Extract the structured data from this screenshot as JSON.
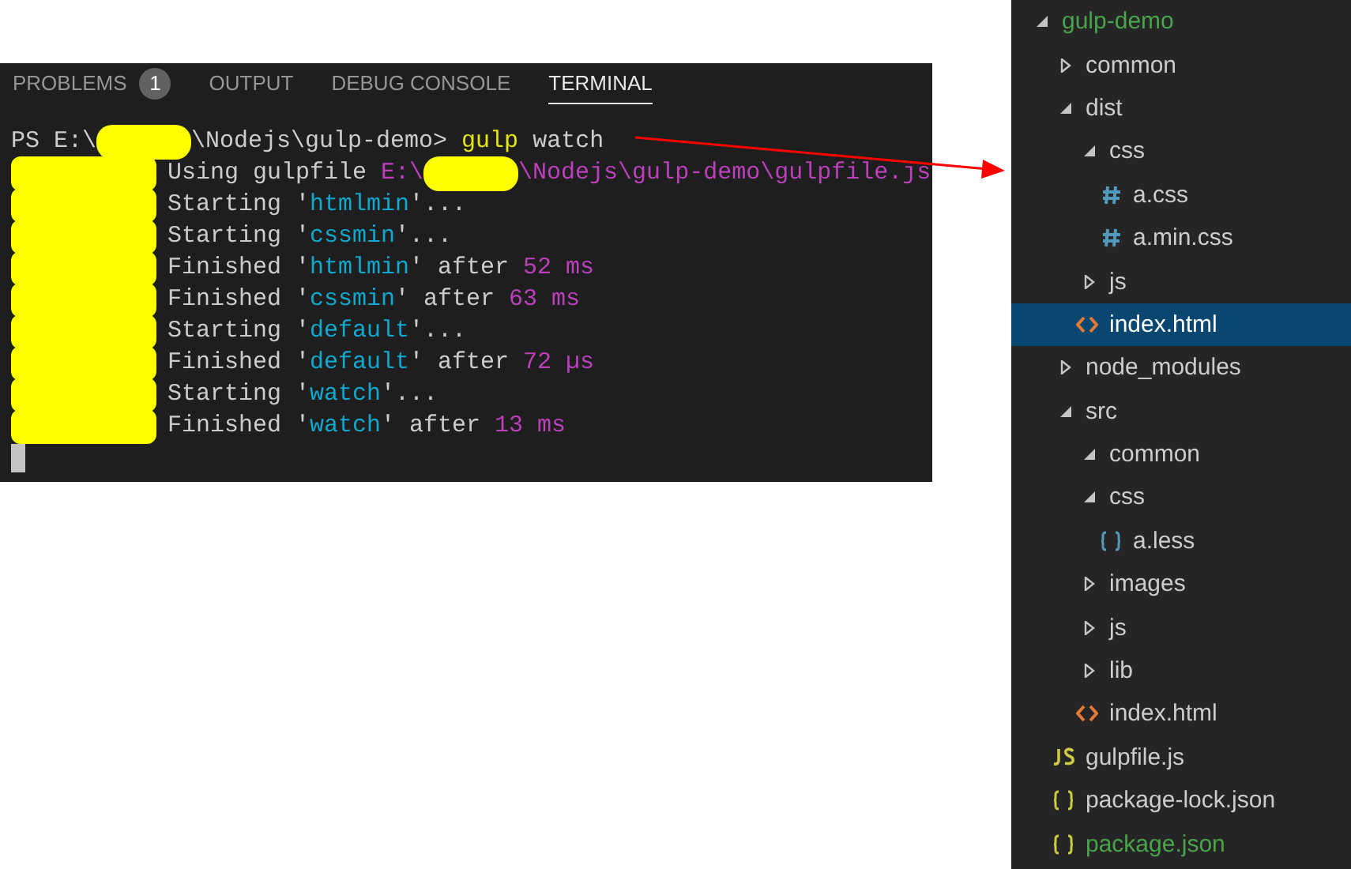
{
  "panel": {
    "tabs": [
      {
        "label": "PROBLEMS",
        "badge": "1",
        "selected": false
      },
      {
        "label": "OUTPUT",
        "selected": false
      },
      {
        "label": "DEBUG CONSOLE",
        "selected": false
      },
      {
        "label": "TERMINAL",
        "selected": true
      }
    ],
    "terminal": {
      "lines": [
        [
          {
            "kind": "plain",
            "text": "PS E:\\"
          },
          {
            "kind": "redaction"
          },
          {
            "kind": "plain",
            "text": "\\Nodejs\\gulp-demo> "
          },
          {
            "kind": "command",
            "text": "gulp"
          },
          {
            "kind": "plain",
            "text": " watch"
          }
        ],
        [
          {
            "kind": "redaction"
          },
          {
            "kind": "plain",
            "text": "Using gulpfile "
          },
          {
            "kind": "number",
            "text": "E:\\"
          },
          {
            "kind": "redaction"
          },
          {
            "kind": "number",
            "text": "\\Nodejs\\gulp-demo\\gulpfile.js"
          }
        ],
        [
          {
            "kind": "redaction"
          },
          {
            "kind": "plain",
            "text": "Starting '"
          },
          {
            "kind": "string",
            "text": "htmlmin"
          },
          {
            "kind": "plain",
            "text": "'..."
          }
        ],
        [
          {
            "kind": "redaction"
          },
          {
            "kind": "plain",
            "text": "Starting '"
          },
          {
            "kind": "string",
            "text": "cssmin"
          },
          {
            "kind": "plain",
            "text": "'..."
          }
        ],
        [
          {
            "kind": "redaction"
          },
          {
            "kind": "plain",
            "text": "Finished '"
          },
          {
            "kind": "string",
            "text": "htmlmin"
          },
          {
            "kind": "plain",
            "text": "' after "
          },
          {
            "kind": "number",
            "text": "52 ms"
          }
        ],
        [
          {
            "kind": "redaction"
          },
          {
            "kind": "plain",
            "text": "Finished '"
          },
          {
            "kind": "string",
            "text": "cssmin"
          },
          {
            "kind": "plain",
            "text": "' after "
          },
          {
            "kind": "number",
            "text": "63 ms"
          }
        ],
        [
          {
            "kind": "redaction"
          },
          {
            "kind": "plain",
            "text": "Starting '"
          },
          {
            "kind": "string",
            "text": "default"
          },
          {
            "kind": "plain",
            "text": "'..."
          }
        ],
        [
          {
            "kind": "redaction"
          },
          {
            "kind": "plain",
            "text": "Finished '"
          },
          {
            "kind": "string",
            "text": "default"
          },
          {
            "kind": "plain",
            "text": "' after "
          },
          {
            "kind": "number",
            "text": "72 µs"
          }
        ],
        [
          {
            "kind": "redaction"
          },
          {
            "kind": "plain",
            "text": "Starting '"
          },
          {
            "kind": "string",
            "text": "watch"
          },
          {
            "kind": "plain",
            "text": "'..."
          }
        ],
        [
          {
            "kind": "redaction"
          },
          {
            "kind": "plain",
            "text": "Finished '"
          },
          {
            "kind": "string",
            "text": "watch"
          },
          {
            "kind": "plain",
            "text": "' after "
          },
          {
            "kind": "number",
            "text": "13 ms"
          }
        ],
        [
          {
            "kind": "cursor"
          }
        ]
      ]
    }
  },
  "explorer": {
    "tree": [
      {
        "label": "gulp-demo",
        "kind": "folder",
        "expanded": true,
        "selected": false,
        "untracked": true,
        "children": [
          {
            "label": "common",
            "kind": "folder",
            "expanded": false,
            "selected": false,
            "untracked": false
          },
          {
            "label": "dist",
            "kind": "folder",
            "expanded": true,
            "selected": false,
            "untracked": false,
            "children": [
              {
                "label": "css",
                "kind": "folder",
                "expanded": true,
                "selected": false,
                "untracked": false,
                "children": [
                  {
                    "label": "a.css",
                    "kind": "css",
                    "selected": false,
                    "untracked": false
                  },
                  {
                    "label": "a.min.css",
                    "kind": "css",
                    "selected": false,
                    "untracked": false
                  }
                ]
              },
              {
                "label": "js",
                "kind": "folder",
                "expanded": false,
                "selected": false,
                "untracked": false
              },
              {
                "label": "index.html",
                "kind": "html",
                "selected": true,
                "untracked": false
              }
            ]
          },
          {
            "label": "node_modules",
            "kind": "folder",
            "expanded": false,
            "selected": false,
            "untracked": false
          },
          {
            "label": "src",
            "kind": "folder",
            "expanded": true,
            "selected": false,
            "untracked": false,
            "children": [
              {
                "label": "common",
                "kind": "folder",
                "expanded": true,
                "selected": false,
                "untracked": false
              },
              {
                "label": "css",
                "kind": "folder",
                "expanded": true,
                "selected": false,
                "untracked": false,
                "children": [
                  {
                    "label": "a.less",
                    "kind": "less",
                    "selected": false,
                    "untracked": false
                  }
                ]
              },
              {
                "label": "images",
                "kind": "folder",
                "expanded": false,
                "selected": false,
                "untracked": false
              },
              {
                "label": "js",
                "kind": "folder",
                "expanded": false,
                "selected": false,
                "untracked": false
              },
              {
                "label": "lib",
                "kind": "folder",
                "expanded": false,
                "selected": false,
                "untracked": false
              },
              {
                "label": "index.html",
                "kind": "html",
                "selected": false,
                "untracked": false
              }
            ]
          },
          {
            "label": "gulpfile.js",
            "kind": "js",
            "selected": false,
            "untracked": false
          },
          {
            "label": "package-lock.json",
            "kind": "json",
            "selected": false,
            "untracked": false
          },
          {
            "label": "package.json",
            "kind": "json",
            "selected": false,
            "untracked": true
          }
        ]
      }
    ]
  }
}
